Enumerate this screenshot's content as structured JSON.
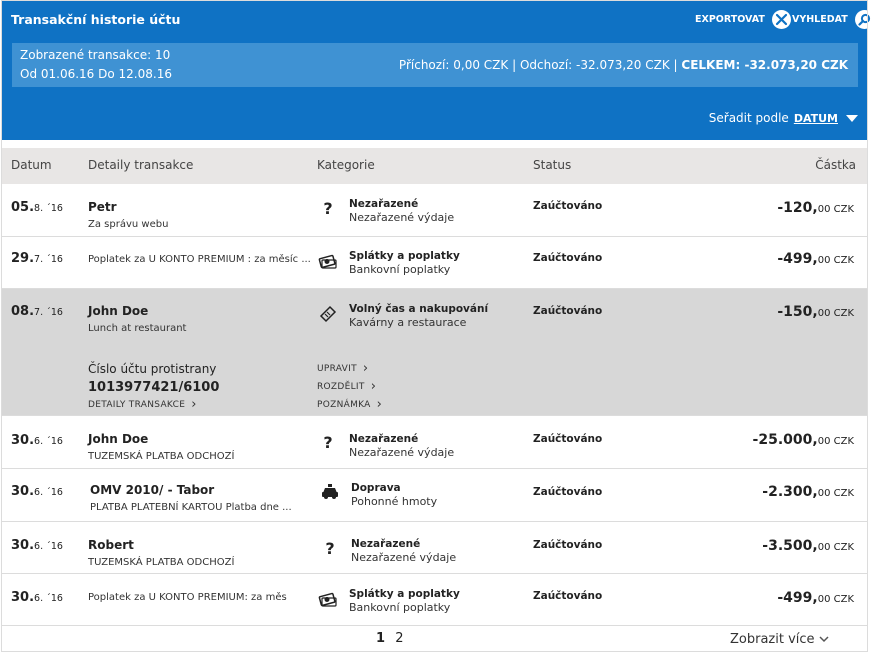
{
  "header": {
    "title": "Transakční historie účtu",
    "export_label": "EXPORTOVAT",
    "search_label": "VYHLEDAT"
  },
  "summary": {
    "shown": "Zobrazené transakce: 10",
    "range": "Od 01.06.16 Do 12.08.16",
    "incoming": "Příchozí: 0,00 CZK",
    "outgoing": "Odchozí: -32.073,20 CZK",
    "total": "CELKEM: -32.073,20 CZK"
  },
  "sort": {
    "label": "Seřadit podle",
    "value": "DATUM"
  },
  "columns": {
    "date": "Datum",
    "details": "Detaily transakce",
    "category": "Kategorie",
    "status": "Status",
    "amount": "Částka"
  },
  "rows": [
    {
      "day": "05.",
      "month": "8. ´16",
      "name": "Petr",
      "sub": "Za správu webu",
      "cat_icon": "question-icon",
      "cat1": "Nezařazené",
      "cat2": "Nezařazené výdaje",
      "status": "Zaúčtováno",
      "amount_main": "-120,",
      "amount_dec": "00 CZK"
    },
    {
      "day": "29.",
      "month": "7. ´16",
      "name": "",
      "sub": "Poplatek za U KONTO PREMIUM : za měsíc ...",
      "cat_icon": "money-icon",
      "cat1": "Splátky a poplatky",
      "cat2": "Bankovní poplatky",
      "status": "Zaúčtováno",
      "amount_main": "-499,",
      "amount_dec": "00 CZK"
    },
    {
      "day": "08.",
      "month": "7. ´16",
      "name": "John Doe",
      "sub": "Lunch at restaurant",
      "cat_icon": "ticket-icon",
      "cat1": "Volný čas a nakupování",
      "cat2": "Kavárny a restaurace",
      "status": "Zaúčtováno",
      "amount_main": "-150,",
      "amount_dec": "00 CZK"
    },
    {
      "day": "30.",
      "month": "6. ´16",
      "name": "John Doe",
      "sub": "TUZEMSKÁ PLATBA ODCHOZÍ",
      "cat_icon": "question-icon",
      "cat1": "Nezařazené",
      "cat2": "Nezařazené výdaje",
      "status": "Zaúčtováno",
      "amount_main": "-25.000,",
      "amount_dec": "00 CZK"
    },
    {
      "day": "30.",
      "month": "6. ´16",
      "name": "OMV 2010/ - Tabor",
      "sub": "PLATBA PLATEBNÍ KARTOU Platba dne ...",
      "cat_icon": "car-icon",
      "cat1": "Doprava",
      "cat2": "Pohonné hmoty",
      "status": "Zaúčtováno",
      "amount_main": "-2.300,",
      "amount_dec": "00 CZK"
    },
    {
      "day": "30.",
      "month": "6. ´16",
      "name": "Robert",
      "sub": "TUZEMSKÁ PLATBA ODCHOZÍ",
      "cat_icon": "question-icon",
      "cat1": "Nezařazené",
      "cat2": "Nezařazené výdaje",
      "status": "Zaúčtováno",
      "amount_main": "-3.500,",
      "amount_dec": "00 CZK"
    },
    {
      "day": "30.",
      "month": "6. ´16",
      "name": "",
      "sub": "Poplatek za U KONTO PREMIUM: za měs",
      "cat_icon": "money-icon",
      "cat1": "Splátky a poplatky",
      "cat2": "Bankovní poplatky",
      "status": "Zaúčtováno",
      "amount_main": "-499,",
      "amount_dec": "00 CZK"
    }
  ],
  "expanded": {
    "account_label": "Číslo účtu protistrany",
    "account_number": "1013977421/6100",
    "details_link": "DETAILY TRANSAKCE",
    "edit_link": "UPRAVIT",
    "split_link": "ROZDĚLIT",
    "note_link": "POZNÁMKA"
  },
  "pagination": {
    "current": "1",
    "next": "2",
    "more": "Zobrazit více"
  },
  "colors": {
    "brand": "#0f72c4",
    "summary_bg": "#3f92d3",
    "selected_row": "#d7d7d7",
    "table_head": "#e8e6e5"
  }
}
